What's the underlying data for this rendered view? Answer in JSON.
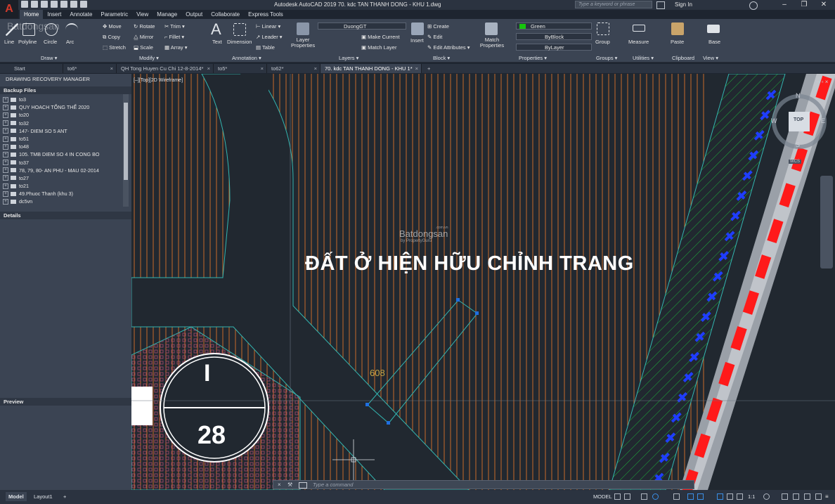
{
  "window": {
    "app_logo": "A",
    "title": "Autodesk AutoCAD 2019    70. kdc TAN THANH DONG - KHU 1.dwg",
    "search_placeholder": "Type a keyword or phrase",
    "sign_in": "Sign In",
    "minimize": "–",
    "maximize": "❐",
    "close": "✕"
  },
  "ribbon_tabs": [
    "Home",
    "Insert",
    "Annotate",
    "Parametric",
    "View",
    "Manage",
    "Output",
    "Collaborate",
    "Express Tools"
  ],
  "ribbon": {
    "draw": {
      "title": "Draw ▾",
      "line": "Line",
      "polyline": "Polyline",
      "circle": "Circle",
      "arc": "Arc"
    },
    "modify": {
      "title": "Modify ▾",
      "move": "Move",
      "rotate": "Rotate",
      "trim": "Trim ▾",
      "copy": "Copy",
      "mirror": "Mirror",
      "fillet": "Fillet ▾",
      "stretch": "Stretch",
      "scale": "Scale",
      "array": "Array ▾"
    },
    "annotation": {
      "title": "Annotation ▾",
      "text": "Text",
      "dimension": "Dimension",
      "linear": "Linear ▾",
      "leader": "Leader ▾",
      "table": "Table"
    },
    "layers": {
      "title": "Layers ▾",
      "layer_properties": "Layer Properties",
      "layer_name": "DuongGT",
      "make_current": "Make Current",
      "match_layer": "Match Layer"
    },
    "block": {
      "title": "Block ▾",
      "insert": "Insert",
      "create": "Create",
      "edit": "Edit",
      "edit_attributes": "Edit Attributes ▾"
    },
    "properties": {
      "title": "Properties ▾",
      "match_properties": "Match Properties",
      "color": "Green",
      "linetype": "ByBlock",
      "lineweight": "ByLayer"
    },
    "groups": {
      "title": "Groups ▾",
      "group": "Group"
    },
    "utilities": {
      "title": "Utilities ▾",
      "measure": "Measure"
    },
    "clipboard": {
      "title": "Clipboard",
      "paste": "Paste"
    },
    "view": {
      "title": "View ▾",
      "base": "Base"
    }
  },
  "doc_tabs": [
    "Start",
    "to6*",
    "QH Tong Huyen Cu Chi 12-8-2014*",
    "to5*",
    "to62*",
    "70. kdc TAN THANH DONG - KHU 1*"
  ],
  "palette": {
    "title": "DRAWING RECOVERY MANAGER",
    "backup_header": "Backup Files",
    "details_header": "Details",
    "preview_header": "Preview",
    "backup_files": [
      "to3",
      "QUY HOACH TỔNG THỂ 2020",
      "to20",
      "to32",
      "147- DIEM SO 5 ANT",
      "to51",
      "to48",
      "105. TMB DIEM SO 4 IN CONG BO",
      "to37",
      "78, 79, 80- AN PHU - MAU 02-2014",
      "to27",
      "to21",
      "49.Phuoc Thanh (khu 3)",
      "dc5vn"
    ]
  },
  "canvas": {
    "view_label": "[–][Top][2D Wireframe]",
    "main_label": "ĐẤT Ở HIỆN HỮU CHỈNH TRANG",
    "lot_number": "608",
    "block_roman": "I",
    "block_number": "28",
    "watermark": "Batdongsan",
    "watermark_sub": "by PropertyGuru",
    "watermark_domain": ".com.vn",
    "viewcube": {
      "top": "TOP",
      "n": "N",
      "s": "S",
      "e": "E",
      "w": "W",
      "wcs": "WCS"
    }
  },
  "command_line": {
    "placeholder": "Type a command"
  },
  "status": {
    "model_tab": "Model",
    "layout_tab": "Layout1",
    "add_tab": "+",
    "model_label": "MODEL",
    "scale": "1:1"
  },
  "colors": {
    "hatch_orange": "#c86a2a",
    "road_cyan": "#33b5b0",
    "block_red": "#ff1a1a",
    "blue_symbols": "#1f3dff"
  }
}
